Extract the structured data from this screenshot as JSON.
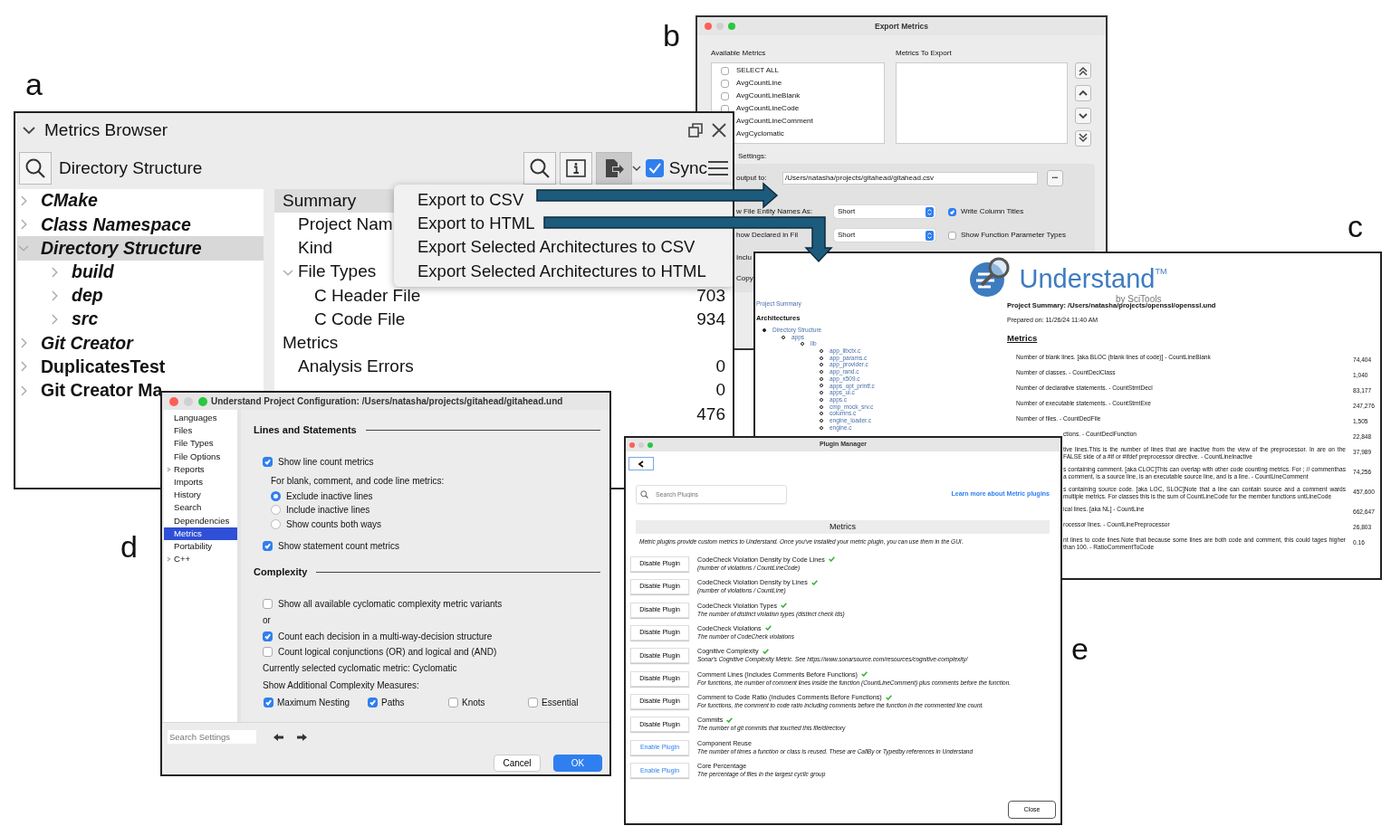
{
  "figure_labels": [
    "a",
    "b",
    "c",
    "d",
    "e"
  ],
  "metrics_browser": {
    "title": "Metrics Browser",
    "scope": "Directory Structure",
    "export_button": {
      "pressed": true
    },
    "sync": {
      "label": "Sync",
      "checked": true
    },
    "tree": [
      {
        "label": "CMake",
        "kind": "architecture",
        "expanded": false,
        "selected": false
      },
      {
        "label": "Class Namespace",
        "kind": "architecture",
        "expanded": false,
        "selected": false
      },
      {
        "label": "Directory Structure",
        "kind": "architecture",
        "expanded": true,
        "selected": true,
        "children": [
          {
            "label": "build",
            "kind": "architecture",
            "expanded": false,
            "selected": false
          },
          {
            "label": "dep",
            "kind": "architecture",
            "expanded": false,
            "selected": false
          },
          {
            "label": "src",
            "kind": "architecture",
            "expanded": false,
            "selected": false
          }
        ]
      },
      {
        "label": "Git Creator",
        "kind": "architecture",
        "expanded": false,
        "selected": false
      },
      {
        "label": "DuplicatesTest",
        "kind": "project",
        "expanded": false,
        "selected": false
      },
      {
        "label": "Git Creator Ma",
        "kind": "project",
        "expanded": false,
        "selected": false
      }
    ],
    "sections": [
      {
        "title": "Summary",
        "selected": true,
        "rows": [
          {
            "label": "Project Nam"
          },
          {
            "label": "Kind"
          },
          {
            "label": "File Types",
            "expanded": true,
            "children": [
              {
                "label": "C Header File",
                "value": "703"
              },
              {
                "label": "C Code File",
                "value": "934"
              }
            ]
          }
        ]
      },
      {
        "title": "Metrics",
        "selected": false,
        "rows": [
          {
            "label": "Analysis Errors",
            "value": "0"
          },
          {
            "value": "0"
          },
          {
            "value": "476"
          }
        ]
      }
    ],
    "export_menu": [
      "Export to CSV",
      "Export to HTML",
      "Export Selected Architectures to CSV",
      "Export Selected Architectures to HTML"
    ]
  },
  "export_metrics": {
    "title": "Export Metrics",
    "available_label": "Available Metrics",
    "export_label": "Metrics To Export",
    "available": [
      {
        "label": "SELECT ALL",
        "checked": false
      },
      {
        "label": "AvgCountLine",
        "checked": false
      },
      {
        "label": "AvgCountLineBlank",
        "checked": false
      },
      {
        "label": "AvgCountLineCode",
        "checked": false
      },
      {
        "label": "AvgCountLineComment"
      },
      {
        "label": "AvgCyclomatic"
      }
    ],
    "settings_label": "Settings:",
    "output_label": "output to:",
    "output_path": "/Users/natasha/projects/gitahead/gitahead.csv",
    "browse": "•••",
    "options": [
      {
        "label": "w File Entity Names As:",
        "select": "Short",
        "check_label": "Write Column Titles",
        "checked": true
      },
      {
        "label": "how Declared in Fil",
        "select": "Short",
        "check_label": "Show Function Parameter Types",
        "checked": false
      }
    ],
    "more_labels": [
      "Inclu",
      "Copy"
    ]
  },
  "html_report": {
    "brand": "Understand",
    "trademark": "TM",
    "byline": "by SciTools",
    "summary_link": "Project Summary",
    "architectures": "Architectures",
    "tree": [
      {
        "label": "Directory Structure",
        "children": [
          {
            "label": "apps",
            "children": [
              {
                "label": "lib",
                "children": [
                  {
                    "label": "app_libctx.c"
                  },
                  {
                    "label": "app_params.c"
                  },
                  {
                    "label": "app_provider.c"
                  },
                  {
                    "label": "app_rand.c"
                  },
                  {
                    "label": "app_x509.c"
                  },
                  {
                    "label": "apps_opt_printf.c"
                  },
                  {
                    "label": "apps_ui.c"
                  },
                  {
                    "label": "apps.c"
                  },
                  {
                    "label": "cmp_mock_srv.c"
                  },
                  {
                    "label": "columns.c"
                  },
                  {
                    "label": "engine_loader.c"
                  },
                  {
                    "label": "engine.c"
                  }
                ]
              }
            ]
          }
        ]
      }
    ],
    "title": "Project Summary: /Users/natasha/projects/openssl/openssl.und",
    "prepared": "Prepared on: 11/26/24 11:40 AM",
    "metrics_heading": "Metrics",
    "metrics": [
      {
        "kind": "full",
        "text": "Number of blank lines. [aka BLOC (blank lines of code)] - CountLineBlank",
        "value": "74,404"
      },
      {
        "kind": "full",
        "text": "Number of classes. - CountDeclClass",
        "value": "1,040"
      },
      {
        "kind": "full",
        "text": "Number of declarative statements. - CountStmtDecl",
        "value": "83,177"
      },
      {
        "kind": "full",
        "text": "Number of executable statements. - CountStmtExe",
        "value": "247,276"
      },
      {
        "kind": "full",
        "text": "Number of files. - CountDeclFile",
        "value": "1,505"
      },
      {
        "kind": "clipped",
        "text": "ctions. - CountDeclFunction",
        "value": "22,848"
      },
      {
        "kind": "clipped",
        "text": "tive lines.This is the number of lines that are inactive from the view of the preprocessor. In are on the FALSE side of a #if or #ifdef preprocessor directive. - CountLineInactive",
        "value": "37,989"
      },
      {
        "kind": "clipped",
        "text": "s containing comment. [aka CLOC]This can overlap with other code counting metrics. For ; // commenthas a comment, is a source line, is an executable source line, and is a line. - CountLineComment",
        "value": "74,256"
      },
      {
        "kind": "clipped",
        "text": "s containing source code. [aka LOC, SLOC]Note that a line can contain source and a comment wards multiple metrics. For classes this is the sum of CountLineCode for the member functions untLineCode",
        "value": "457,600"
      },
      {
        "kind": "clipped",
        "text": "ical lines. [aka NL] - CountLine",
        "value": "662,647"
      },
      {
        "kind": "clipped",
        "text": "rocessor lines. - CountLinePreprocessor",
        "value": "26,803"
      },
      {
        "kind": "clipped",
        "text": "nt lines to code lines.Note that because some lines are both code and comment, this could tages higher than 100. - RatioCommentToCode",
        "value": "0.16"
      }
    ]
  },
  "project_configuration": {
    "title": "Understand Project Configuration: /Users/natasha/projects/gitahead/gitahead.und",
    "sidebar": [
      {
        "label": "Languages",
        "selected": false
      },
      {
        "label": "Files",
        "selected": false
      },
      {
        "label": "File Types",
        "selected": false
      },
      {
        "label": "File Options",
        "selected": false
      },
      {
        "label": "Reports",
        "selected": false,
        "expandable": true
      },
      {
        "label": "Imports",
        "selected": false
      },
      {
        "label": "History",
        "selected": false
      },
      {
        "label": "Search",
        "selected": false
      },
      {
        "label": "Dependencies",
        "selected": false
      },
      {
        "label": "Metrics",
        "selected": true
      },
      {
        "label": "Portability",
        "selected": false
      },
      {
        "label": "C++",
        "selected": false,
        "expandable": true
      }
    ],
    "content": [
      {
        "kind": "section",
        "label": "Lines and Statements"
      },
      {
        "kind": "checkbox",
        "label": "Show line count metrics",
        "checked": true,
        "children": [
          {
            "kind": "text",
            "label": "For blank, comment, and code line metrics:"
          },
          {
            "kind": "radio",
            "label": "Exclude inactive lines",
            "selected": true
          },
          {
            "kind": "radio",
            "label": "Include inactive lines",
            "selected": false
          },
          {
            "kind": "radio",
            "label": "Show counts both ways",
            "selected": false
          }
        ]
      },
      {
        "kind": "checkbox",
        "label": "Show statement count metrics",
        "checked": true
      },
      {
        "kind": "section",
        "label": "Complexity"
      },
      {
        "kind": "checkbox",
        "label": "Show all available cyclomatic complexity metric variants",
        "checked": false
      },
      {
        "kind": "text",
        "label": "or"
      },
      {
        "kind": "checkbox",
        "label": "Count each decision in a multi-way-decision structure",
        "checked": true
      },
      {
        "kind": "checkbox",
        "label": "Count logical conjunctions (OR) and logical and (AND)",
        "checked": false
      },
      {
        "kind": "text",
        "label": "Currently selected cyclomatic metric: Cyclomatic"
      },
      {
        "kind": "text",
        "label": "Show Additional Complexity Measures:"
      },
      {
        "kind": "checkbox_row",
        "options": [
          {
            "label": "Maximum Nesting",
            "checked": true
          },
          {
            "label": "Paths",
            "checked": true
          },
          {
            "label": "Knots",
            "checked": false
          },
          {
            "label": "Essential",
            "checked": false
          }
        ]
      }
    ],
    "search_placeholder": "Search Settings",
    "cancel": "Cancel",
    "ok": "OK"
  },
  "plugin_manager": {
    "title": "Plugin Manager",
    "search_placeholder": "Search Plugins",
    "learn_more": "Learn more about Metric plugins",
    "heading": "Metrics",
    "intro": "Metric plugins provide custom metrics to Understand. Once you've installed your metric plugin, you can use them in the GUI.",
    "plugins": [
      {
        "action": "Disable Plugin",
        "enabled": true,
        "name": "CodeCheck Violation Density by Code Lines",
        "description": "(number of violations / CountLineCode)"
      },
      {
        "action": "Disable Plugin",
        "enabled": true,
        "name": "CodeCheck Violation Density by Lines",
        "description": "(number of violations / CountLine)"
      },
      {
        "action": "Disable Plugin",
        "enabled": true,
        "name": "CodeCheck Violation Types",
        "description": "The number of distinct violation types (distinct check ids)"
      },
      {
        "action": "Disable Plugin",
        "enabled": true,
        "name": "CodeCheck Violations",
        "description": "The number of CodeCheck violations"
      },
      {
        "action": "Disable Plugin",
        "enabled": true,
        "name": "Cognitive Complexity",
        "description": "Sonar's Cognitive Complexity Metric. See https://www.sonarsource.com/resources/cognitive-complexity/"
      },
      {
        "action": "Disable Plugin",
        "enabled": true,
        "name": "Comment Lines (Includes Comments Before Functions)",
        "description": "For functions, the number of comment lines inside the function (CountLineComment) plus comments before the function."
      },
      {
        "action": "Disable Plugin",
        "enabled": true,
        "name": "Comment to Code Ratio (Includes Comments Before Functions)",
        "description": "For functions, the comment to code ratio including comments before the function in the commented line count."
      },
      {
        "action": "Disable Plugin",
        "enabled": true,
        "name": "Commits",
        "description": "The number of git commits that touched this file/directory"
      },
      {
        "action": "Enable Plugin",
        "enabled": false,
        "name": "Component Reuse",
        "description": "The number of times a function or class is reused. These are CallBy or Typedby references in Understand"
      },
      {
        "action": "Enable Plugin",
        "enabled": false,
        "name": "Core Percentage",
        "description": "The percentage of files in the largest cyclic group"
      }
    ],
    "close": "Close"
  }
}
